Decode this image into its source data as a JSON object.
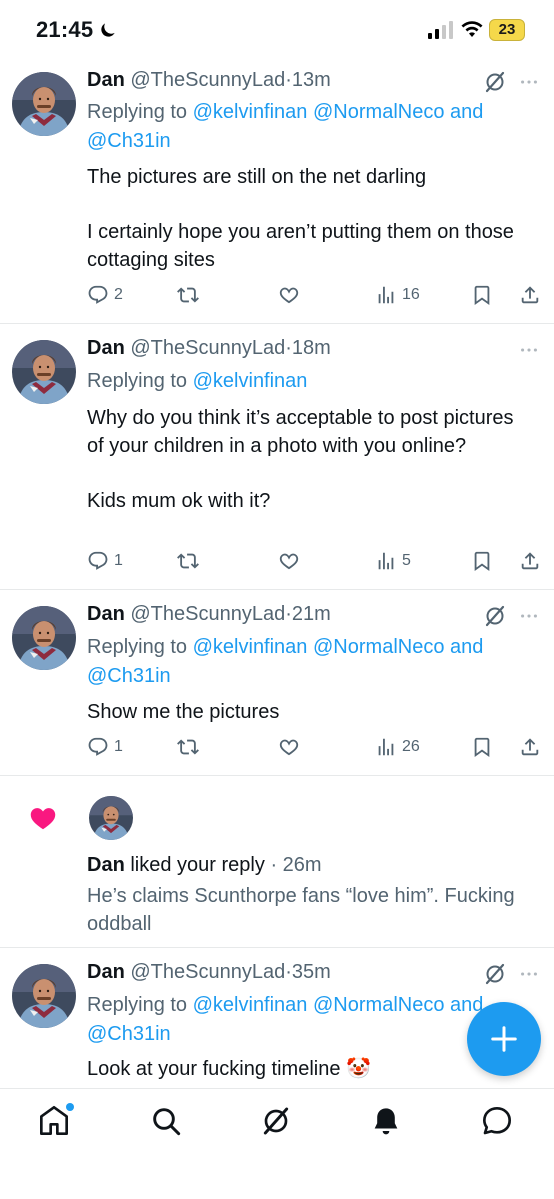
{
  "status_bar": {
    "time": "21:45",
    "battery": "23"
  },
  "tweets": [
    {
      "name": "Dan",
      "handle": "@TheScunnyLad",
      "dot": "·",
      "time": "13m",
      "replying_prefix": "Replying to",
      "mentions": [
        "@kelvinfinan",
        "@NormalNeco",
        "@Ch31in"
      ],
      "and_word": "and",
      "paragraphs": [
        "The pictures are still on the net darling",
        "I certainly hope you aren’t putting them on those cottaging sites"
      ],
      "replies": "2",
      "views": "16"
    },
    {
      "name": "Dan",
      "handle": "@TheScunnyLad",
      "dot": "·",
      "time": "18m",
      "replying_prefix": "Replying to",
      "mentions": [
        "@kelvinfinan"
      ],
      "paragraphs": [
        "Why do you think it’s acceptable to post pictures of your children in a photo with you online?",
        "Kids mum ok with it?"
      ],
      "replies": "1",
      "views": "5"
    },
    {
      "name": "Dan",
      "handle": "@TheScunnyLad",
      "dot": "·",
      "time": "21m",
      "replying_prefix": "Replying to",
      "mentions": [
        "@kelvinfinan",
        "@NormalNeco",
        "@Ch31in"
      ],
      "and_word": "and",
      "paragraphs": [
        "Show me the pictures"
      ],
      "replies": "1",
      "views": "26"
    }
  ],
  "notification": {
    "name": "Dan",
    "action": "liked your reply",
    "dot": "·",
    "time": "26m",
    "quote": "He’s claims Scunthorpe fans “love him”. Fucking oddball"
  },
  "last_tweet": {
    "name": "Dan",
    "handle": "@TheScunnyLad",
    "dot": "·",
    "time": "35m",
    "replying_prefix": "Replying to",
    "mentions": [
      "@kelvinfinan",
      "@NormalNeco",
      "@Ch31in"
    ],
    "and_word": "and",
    "text": "Look at your fucking timeline",
    "emoji": "🤡"
  },
  "colors": {
    "accent": "#1d9bf0",
    "like": "#f91880",
    "muted": "#536471",
    "text": "#0f1419"
  },
  "icons": {
    "status": [
      "moon-icon",
      "signal-icon",
      "wifi-icon",
      "battery-icon"
    ],
    "tweet": [
      "grok-icon",
      "more-icon",
      "reply-icon",
      "retweet-icon",
      "like-icon",
      "views-icon",
      "bookmark-icon",
      "share-icon"
    ],
    "nav": [
      "home-icon",
      "search-icon",
      "grok-icon",
      "notifications-icon",
      "messages-icon"
    ],
    "fab": "compose-plus-icon"
  }
}
